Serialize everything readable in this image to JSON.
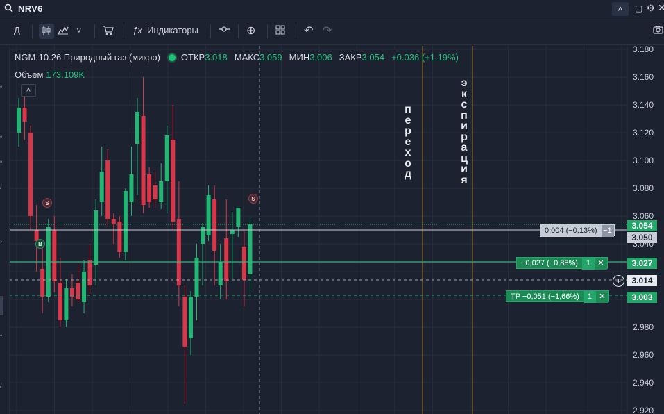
{
  "topbar": {
    "search_icon": "search-icon",
    "symbol": "NRV6",
    "collapse_icon": "˄",
    "window_icon": "▢",
    "settings_icon": "⚙",
    "close_icon": "✕"
  },
  "toolbar": {
    "period": "Д",
    "candles_icon": "candles-icon",
    "area_icon": "area-chart-icon",
    "dropdown_icon": "˅",
    "cart_icon": "cart-icon",
    "fx_label": "ƒx",
    "indicators_label": "Индикаторы",
    "compare_icon": "-o-",
    "add_icon": "⊕",
    "layout_icon": "▦",
    "undo_icon": "↶",
    "redo_icon": "↷",
    "camera_icon": "camera-icon"
  },
  "legend": {
    "name": "NGM-10.26 Природный газ (микро)",
    "open_label": "ОТКР",
    "open_value": "3.018",
    "high_label": "МАКС",
    "high_value": "3.059",
    "low_label": "МИН",
    "low_value": "3.006",
    "close_label": "ЗАКР",
    "close_value": "3.054",
    "change": "+0.036 (+1.19%)"
  },
  "volume": {
    "label": "Объем",
    "value": "173.109K"
  },
  "collapse_button": "˄",
  "markers": {
    "sell": "S",
    "buy": "B"
  },
  "vertical_labels": {
    "rollover": "переход",
    "expiration": "экспирация"
  },
  "price_tags": {
    "last": "3.054",
    "line_a": "3.050",
    "position": "3.027",
    "cursor": "3.014",
    "take_profit": "3.003"
  },
  "orders": {
    "line_a_label": "0,004 (−0,13%)",
    "line_a_qty": "−1",
    "position_label": "−0,027 (−0,88%)",
    "position_qty": "1",
    "tp_label": "TP −0,051 (−1,66%)",
    "tp_qty": "1",
    "close_glyph": "✕"
  },
  "cursor_plus": "+",
  "colors": {
    "up": "#22b573",
    "down": "#d8374a",
    "background": "#1c2230",
    "grid": "#262d3b",
    "vertical_line": "#a07a2a",
    "position_line": "#2fb878"
  },
  "chart_data": {
    "type": "candlestick",
    "ylim": [
      2.92,
      3.18
    ],
    "y_ticks": [
      "3.180",
      "3.160",
      "3.140",
      "3.120",
      "3.100",
      "3.080",
      "3.060",
      "3.040",
      "2.980",
      "2.960",
      "2.940",
      "2.920"
    ],
    "candles": [
      {
        "o": 3.12,
        "h": 3.145,
        "l": 3.11,
        "c": 3.138
      },
      {
        "o": 3.138,
        "h": 3.15,
        "l": 3.115,
        "c": 3.128
      },
      {
        "o": 3.12,
        "h": 3.125,
        "l": 3.05,
        "c": 3.06
      },
      {
        "o": 3.05,
        "h": 3.068,
        "l": 3.02,
        "c": 3.042
      },
      {
        "o": 3.022,
        "h": 3.04,
        "l": 2.99,
        "c": 3.002
      },
      {
        "o": 3.002,
        "h": 3.058,
        "l": 2.998,
        "c": 3.052
      },
      {
        "o": 3.05,
        "h": 3.06,
        "l": 3.005,
        "c": 3.013
      },
      {
        "o": 3.012,
        "h": 3.03,
        "l": 2.98,
        "c": 2.985
      },
      {
        "o": 2.985,
        "h": 3.015,
        "l": 2.98,
        "c": 3.008
      },
      {
        "o": 3.008,
        "h": 3.018,
        "l": 2.995,
        "c": 3.002
      },
      {
        "o": 3.012,
        "h": 3.025,
        "l": 2.998,
        "c": 3.0
      },
      {
        "o": 2.998,
        "h": 3.028,
        "l": 2.99,
        "c": 3.02
      },
      {
        "o": 3.028,
        "h": 3.04,
        "l": 3.004,
        "c": 3.01
      },
      {
        "o": 3.025,
        "h": 3.072,
        "l": 3.01,
        "c": 3.064
      },
      {
        "o": 3.07,
        "h": 3.11,
        "l": 3.06,
        "c": 3.092
      },
      {
        "o": 3.1,
        "h": 3.108,
        "l": 3.052,
        "c": 3.058
      },
      {
        "o": 3.058,
        "h": 3.062,
        "l": 3.04,
        "c": 3.054
      },
      {
        "o": 3.056,
        "h": 3.06,
        "l": 3.03,
        "c": 3.034
      },
      {
        "o": 3.034,
        "h": 3.08,
        "l": 3.028,
        "c": 3.078
      },
      {
        "o": 3.07,
        "h": 3.11,
        "l": 3.06,
        "c": 3.09
      },
      {
        "o": 3.112,
        "h": 3.145,
        "l": 3.075,
        "c": 3.135
      },
      {
        "o": 3.132,
        "h": 3.16,
        "l": 3.062,
        "c": 3.068
      },
      {
        "o": 3.09,
        "h": 3.095,
        "l": 3.066,
        "c": 3.07
      },
      {
        "o": 3.082,
        "h": 3.092,
        "l": 3.066,
        "c": 3.072
      },
      {
        "o": 3.07,
        "h": 3.098,
        "l": 3.065,
        "c": 3.085
      },
      {
        "o": 3.085,
        "h": 3.125,
        "l": 3.062,
        "c": 3.118
      },
      {
        "o": 3.115,
        "h": 3.14,
        "l": 3.05,
        "c": 3.056
      },
      {
        "o": 3.058,
        "h": 3.085,
        "l": 2.995,
        "c": 3.01
      },
      {
        "o": 3.002,
        "h": 3.01,
        "l": 2.925,
        "c": 2.966
      },
      {
        "o": 2.972,
        "h": 3.006,
        "l": 2.96,
        "c": 3.002
      },
      {
        "o": 3.002,
        "h": 3.04,
        "l": 2.985,
        "c": 3.03
      },
      {
        "o": 3.04,
        "h": 3.055,
        "l": 3.01,
        "c": 3.052
      },
      {
        "o": 3.046,
        "h": 3.082,
        "l": 3.042,
        "c": 3.075
      },
      {
        "o": 3.072,
        "h": 3.082,
        "l": 3.01,
        "c": 3.035
      },
      {
        "o": 3.01,
        "h": 3.04,
        "l": 3.0,
        "c": 3.027
      },
      {
        "o": 3.044,
        "h": 3.072,
        "l": 3.0,
        "c": 3.013
      },
      {
        "o": 3.047,
        "h": 3.063,
        "l": 3.015,
        "c": 3.05
      },
      {
        "o": 3.052,
        "h": 3.066,
        "l": 3.045,
        "c": 3.066
      },
      {
        "o": 3.038,
        "h": 3.05,
        "l": 2.995,
        "c": 3.014
      },
      {
        "o": 3.018,
        "h": 3.059,
        "l": 3.006,
        "c": 3.054
      }
    ],
    "horizontal_lines": [
      3.05,
      3.027,
      3.014,
      3.003
    ],
    "vertical_markers": [
      "переход",
      "экспирация"
    ]
  }
}
